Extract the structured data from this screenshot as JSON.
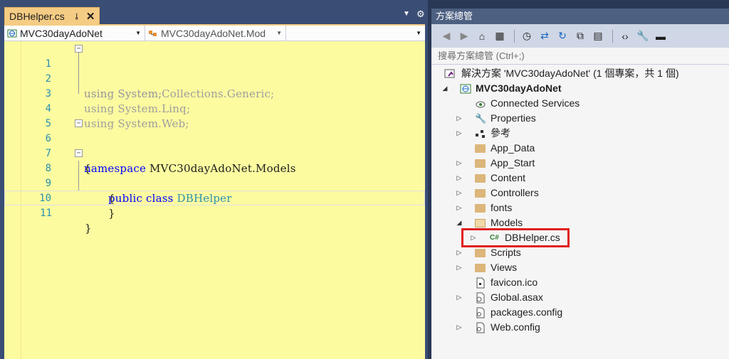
{
  "editor": {
    "tab": {
      "title": "DBHelper.cs",
      "pin_icon": "pin-icon",
      "close": "✕"
    },
    "nav": {
      "project": "MVC30dayAdoNet",
      "class": "MVC30dayAdoNet.Mod",
      "member": ""
    },
    "code_lines": [
      {
        "n": "1",
        "text": "using System;"
      },
      {
        "n": "2",
        "text": "using System.Collections.Generic;"
      },
      {
        "n": "3",
        "text": "using System.Linq;"
      },
      {
        "n": "4",
        "text": "using System.Web;"
      },
      {
        "n": "5",
        "text": ""
      },
      {
        "n": "6",
        "text": "namespace MVC30dayAdoNet.Models"
      },
      {
        "n": "7",
        "text": "{"
      },
      {
        "n": "8",
        "text": "public class DBHelper"
      },
      {
        "n": "9",
        "text": "{"
      },
      {
        "n": "10",
        "text": "}"
      },
      {
        "n": "11",
        "text": "}"
      }
    ],
    "code_tokens": {
      "using": "using",
      "namespace_kw": "namespace",
      "namespace_name": "MVC30dayAdoNet.Models",
      "public_kw": "public",
      "class_kw": "class",
      "class_name": "DBHelper"
    }
  },
  "solution_explorer": {
    "title": "方案總管",
    "search_placeholder": "搜尋方案總管 (Ctrl+;)",
    "solution": "解決方案 'MVC30dayAdoNet' (1 個專案，共 1 個)",
    "project": "MVC30dayAdoNet",
    "items": [
      {
        "label": "Connected Services",
        "icon": "connected-services-icon"
      },
      {
        "label": "Properties",
        "icon": "wrench-icon"
      },
      {
        "label": "參考",
        "icon": "references-icon"
      },
      {
        "label": "App_Data",
        "icon": "folder-icon"
      },
      {
        "label": "App_Start",
        "icon": "folder-icon"
      },
      {
        "label": "Content",
        "icon": "folder-icon"
      },
      {
        "label": "Controllers",
        "icon": "folder-icon"
      },
      {
        "label": "fonts",
        "icon": "folder-icon"
      },
      {
        "label": "Models",
        "icon": "folder-open-icon"
      },
      {
        "label": "DBHelper.cs",
        "icon": "csharp-file-icon"
      },
      {
        "label": "Scripts",
        "icon": "folder-icon"
      },
      {
        "label": "Views",
        "icon": "folder-icon"
      },
      {
        "label": "favicon.ico",
        "icon": "file-icon"
      },
      {
        "label": "Global.asax",
        "icon": "global-asax-icon"
      },
      {
        "label": "packages.config",
        "icon": "config-file-icon"
      },
      {
        "label": "Web.config",
        "icon": "config-file-icon"
      }
    ]
  },
  "colors": {
    "editor_background": "#fdfba0",
    "tab_active": "#f5cc84",
    "chrome": "#293955",
    "highlight": "#e02020"
  }
}
